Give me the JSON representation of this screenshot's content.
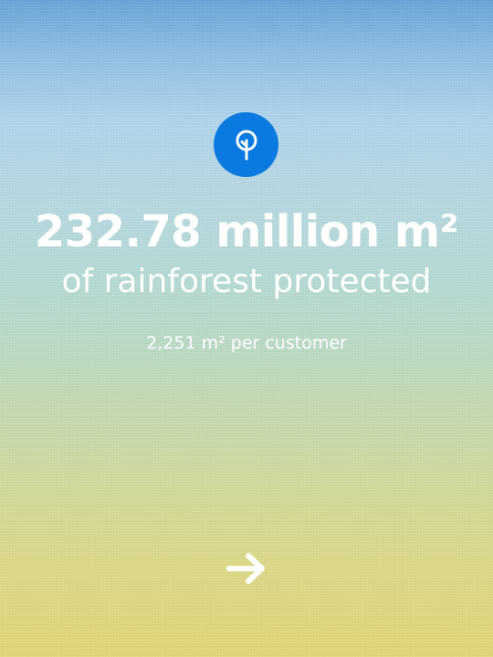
{
  "stat": {
    "headline": "232.78 million m²",
    "subline": "of rainforest protected",
    "per_customer": "2,251 m² per customer"
  },
  "icons": {
    "badge": "tree-icon",
    "next": "arrow-right-icon"
  },
  "colors": {
    "badge": "#0a7ae0",
    "text": "#ffffff"
  }
}
